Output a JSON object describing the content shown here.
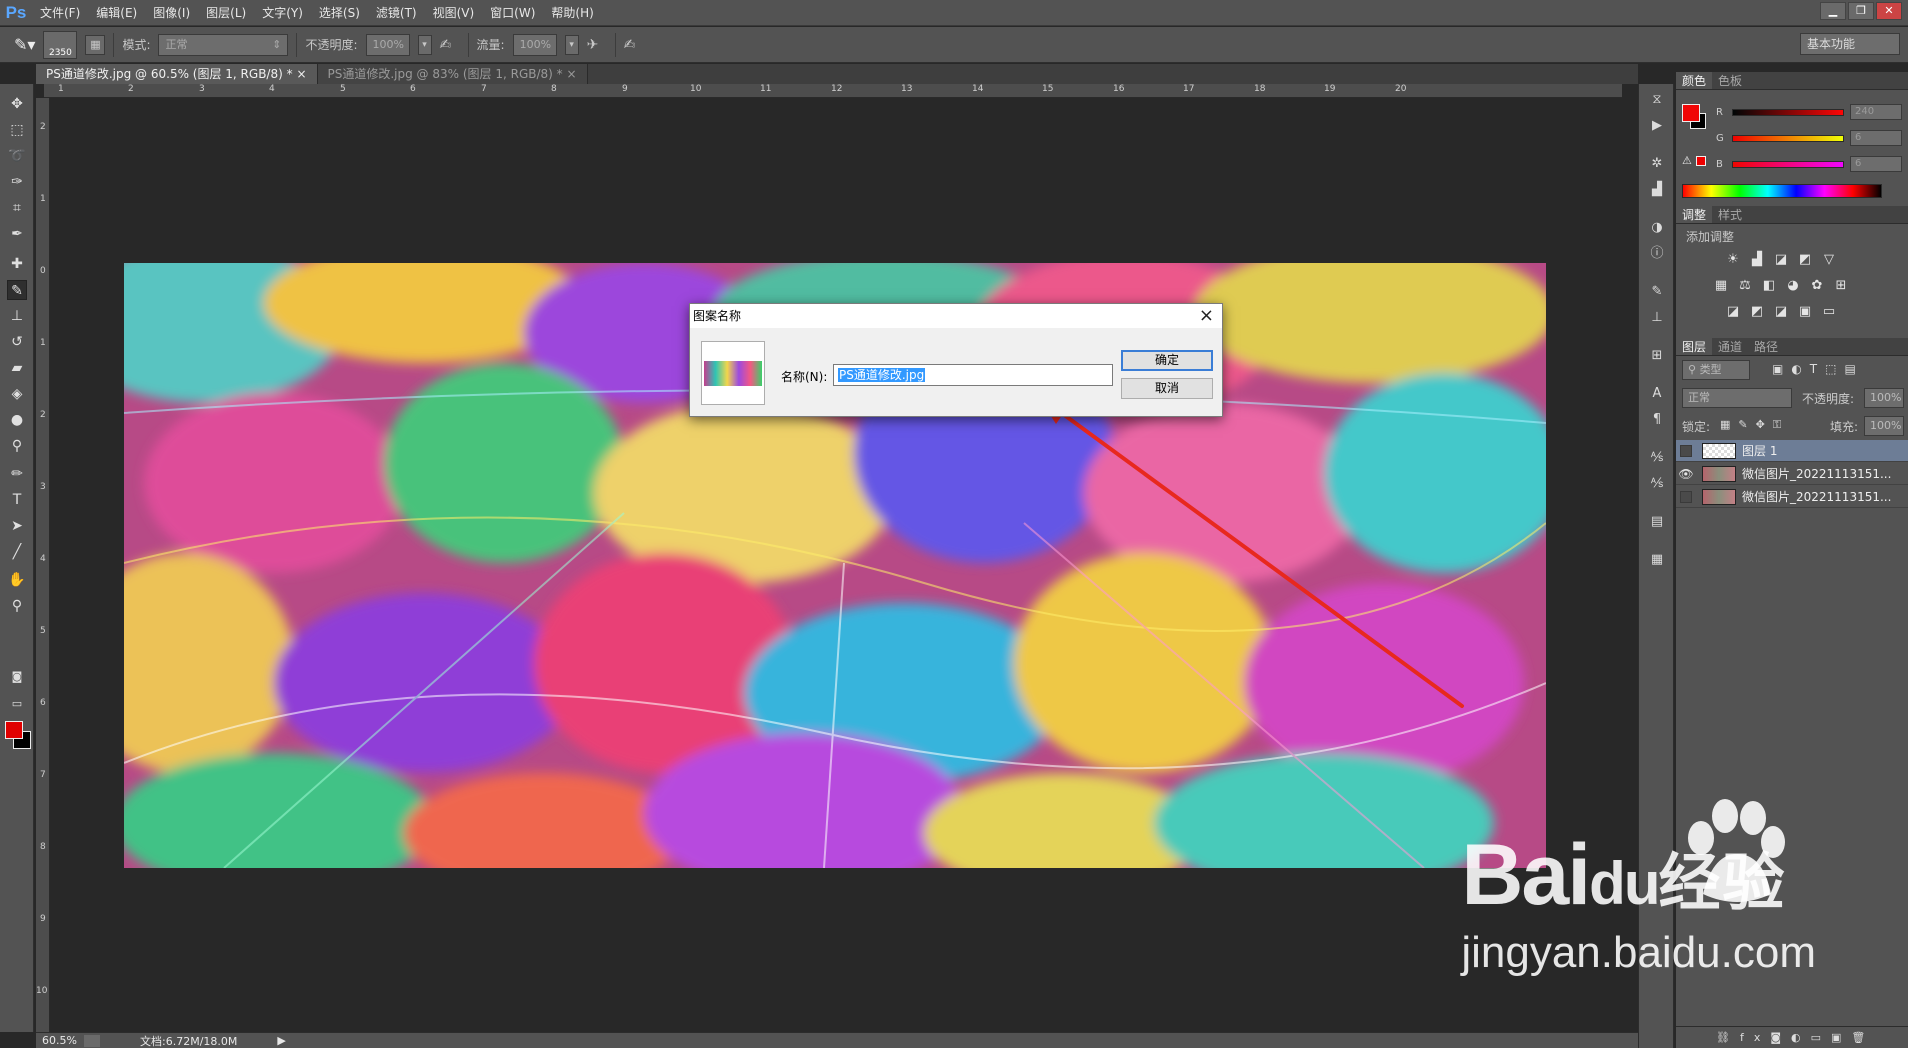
{
  "app": {
    "logo": "Ps"
  },
  "menu": [
    "文件(F)",
    "编辑(E)",
    "图像(I)",
    "图层(L)",
    "文字(Y)",
    "选择(S)",
    "滤镜(T)",
    "视图(V)",
    "窗口(W)",
    "帮助(H)"
  ],
  "options": {
    "brush_size": "2350",
    "mode_label": "模式:",
    "mode_value": "正常",
    "opacity_label": "不透明度:",
    "opacity_value": "100%",
    "flow_label": "流量:",
    "flow_value": "100%",
    "workspace": "基本功能"
  },
  "tabs": [
    {
      "label": "PS通道修改.jpg @ 60.5% (图层 1, RGB/8) *",
      "close": "×"
    },
    {
      "label": "PS通道修改.jpg @ 83% (图层 1, RGB/8) *",
      "close": "×"
    }
  ],
  "ruler_top": [
    "1",
    "2",
    "3",
    "4",
    "5",
    "6",
    "7",
    "8",
    "9",
    "10",
    "11",
    "12",
    "13",
    "14",
    "15",
    "16",
    "17",
    "18",
    "19",
    "20"
  ],
  "ruler_left": [
    "2",
    "1",
    "0",
    "1",
    "2",
    "3",
    "4",
    "5",
    "6",
    "7",
    "8",
    "9",
    "10"
  ],
  "status": {
    "zoom": "60.5%",
    "doc": "文档:6.72M/18.0M"
  },
  "color_panel": {
    "tabs": [
      "颜色",
      "色板"
    ],
    "r_label": "R",
    "r_value": "240",
    "g_label": "G",
    "g_value": "6",
    "b_label": "B",
    "b_value": "6",
    "foreground": "#f00606"
  },
  "adjust_panel": {
    "tabs": [
      "调整",
      "样式"
    ],
    "add_label": "添加调整"
  },
  "layers_panel": {
    "tabs": [
      "图层",
      "通道",
      "路径"
    ],
    "filter_kind": "类型",
    "blend_mode": "正常",
    "opacity_label": "不透明度:",
    "opacity_value": "100%",
    "lock_label": "锁定:",
    "fill_label": "填充:",
    "fill_value": "100%",
    "layers": [
      {
        "name": "图层 1",
        "selected": true,
        "visible": false
      },
      {
        "name": "微信图片_20221113151...",
        "selected": false,
        "visible": true
      },
      {
        "name": "微信图片_20221113151...",
        "selected": false,
        "visible": false
      }
    ]
  },
  "dialog": {
    "title": "图案名称",
    "name_label": "名称(N):",
    "name_value": "PS通道修改.jpg",
    "ok": "确定",
    "cancel": "取消",
    "close": "×"
  },
  "watermark": {
    "main": "Bai",
    "du": "du",
    "suffix": "经验",
    "url": "jingyan.baidu.com"
  },
  "colors": {
    "accent": "#3399ff",
    "arrow": "#e8281e",
    "selected_layer": "#6d7d96"
  }
}
